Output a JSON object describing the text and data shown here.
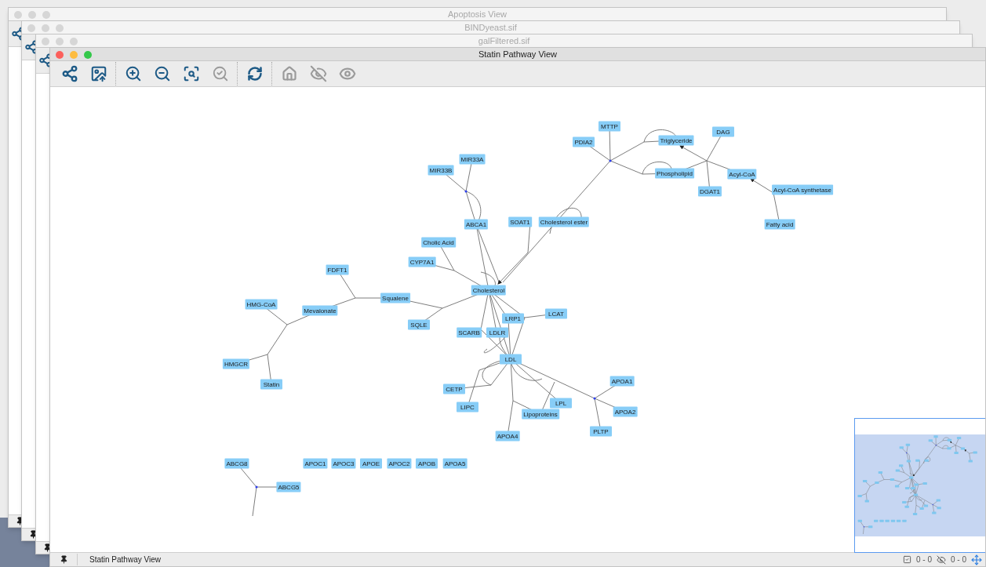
{
  "windows": [
    {
      "title": "Apoptosis View",
      "active": false
    },
    {
      "title": "BINDyeast.sif",
      "active": false
    },
    {
      "title": "galFiltered.sif",
      "active": false
    },
    {
      "title": "Statin Pathway View",
      "active": true
    }
  ],
  "toolbar": {
    "groups": [
      [
        {
          "kind": "network-export",
          "enabled": true
        },
        {
          "kind": "image-export",
          "enabled": true
        }
      ],
      [
        {
          "kind": "zoom-in",
          "enabled": true
        },
        {
          "kind": "zoom-out",
          "enabled": true
        },
        {
          "kind": "zoom-fit",
          "enabled": true
        },
        {
          "kind": "zoom-selected",
          "enabled": false
        }
      ],
      [
        {
          "kind": "refresh",
          "enabled": true
        }
      ],
      [
        {
          "kind": "home",
          "enabled": false
        },
        {
          "kind": "hide",
          "enabled": false
        },
        {
          "kind": "show",
          "enabled": false
        }
      ]
    ]
  },
  "network": {
    "nodes": [
      {
        "label": "MTTP"
      },
      {
        "label": "PDIA2"
      },
      {
        "label": "Triglyceride"
      },
      {
        "label": "DAG"
      },
      {
        "label": "MIR33A"
      },
      {
        "label": "MIR33B"
      },
      {
        "label": "Phospholipid"
      },
      {
        "label": "Acyl-CoA"
      },
      {
        "label": "DGAT1"
      },
      {
        "label": "Acyl-CoA synthetase"
      },
      {
        "label": "SOAT1"
      },
      {
        "label": "Cholesterol ester"
      },
      {
        "label": "ABCA1"
      },
      {
        "label": "Fatty acid"
      },
      {
        "label": "Cholic Acid"
      },
      {
        "label": "CYP7A1"
      },
      {
        "label": "FDFT1"
      },
      {
        "label": "Cholesterol"
      },
      {
        "label": "Squalene"
      },
      {
        "label": "HMG-CoA"
      },
      {
        "label": "Mevalonate"
      },
      {
        "label": "LCAT"
      },
      {
        "label": "LRP1"
      },
      {
        "label": "SQLE"
      },
      {
        "label": "SCARB"
      },
      {
        "label": "LDLR"
      },
      {
        "label": "LDL"
      },
      {
        "label": "HMGCR"
      },
      {
        "label": "APOA1"
      },
      {
        "label": "Statin"
      },
      {
        "label": "CETP"
      },
      {
        "label": "LPL"
      },
      {
        "label": "APOA2"
      },
      {
        "label": "LIPC"
      },
      {
        "label": "Lipoproteins"
      },
      {
        "label": "PLTP"
      },
      {
        "label": "APOA4"
      },
      {
        "label": "ABCG8"
      },
      {
        "label": "APOC1"
      },
      {
        "label": "APOC3"
      },
      {
        "label": "APOE"
      },
      {
        "label": "APOC2"
      },
      {
        "label": "APOB"
      },
      {
        "label": "APOA5"
      },
      {
        "label": "ABCG5"
      }
    ]
  },
  "status_bar": {
    "title": "Statin Pathway View",
    "selected_count": "0 - 0",
    "hidden_count": "0 - 0"
  }
}
